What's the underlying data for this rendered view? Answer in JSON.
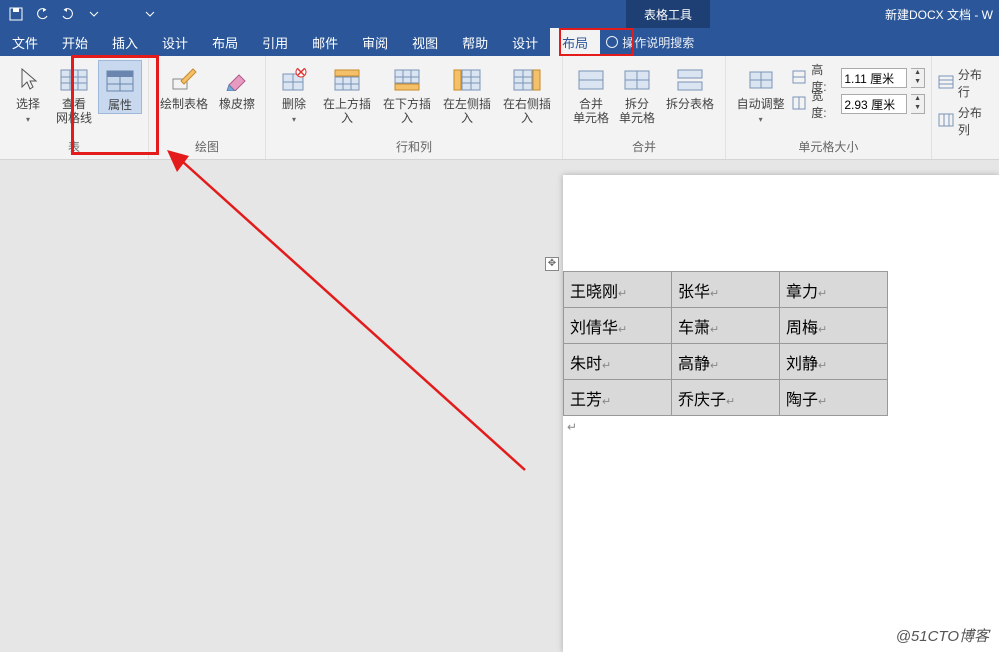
{
  "titlebar": {
    "context_tab": "表格工具",
    "doc_title": "新建DOCX 文档 - W"
  },
  "tabs": {
    "file": "文件",
    "home": "开始",
    "insert": "插入",
    "design": "设计",
    "layout": "布局",
    "references": "引用",
    "mailings": "邮件",
    "review": "审阅",
    "view": "视图",
    "help": "帮助",
    "tbl_design": "设计",
    "tbl_layout": "布局",
    "tell_me": "操作说明搜索"
  },
  "ribbon": {
    "select": "选择",
    "gridlines": "查看\n网格线",
    "properties": "属性",
    "group_table": "表",
    "draw_table": "绘制表格",
    "eraser": "橡皮擦",
    "group_draw": "绘图",
    "delete": "删除",
    "ins_above": "在上方插入",
    "ins_below": "在下方插入",
    "ins_left": "在左侧插入",
    "ins_right": "在右侧插入",
    "group_rowcol": "行和列",
    "merge": "合并\n单元格",
    "split": "拆分\n单元格",
    "split_tbl": "拆分表格",
    "group_merge": "合并",
    "autofit": "自动调整",
    "height_lbl": "高度:",
    "height_val": "1.11 厘米",
    "width_lbl": "宽度:",
    "width_val": "2.93 厘米",
    "group_size": "单元格大小",
    "dist_rows": "分布行",
    "dist_cols": "分布列"
  },
  "table": {
    "rows": [
      [
        "王晓刚",
        "张华",
        "章力"
      ],
      [
        "刘倩华",
        "车萧",
        "周梅"
      ],
      [
        "朱时",
        "高静",
        "刘静"
      ],
      [
        "王芳",
        "乔庆子",
        "陶子"
      ]
    ]
  },
  "watermark": "@51CTO博客"
}
